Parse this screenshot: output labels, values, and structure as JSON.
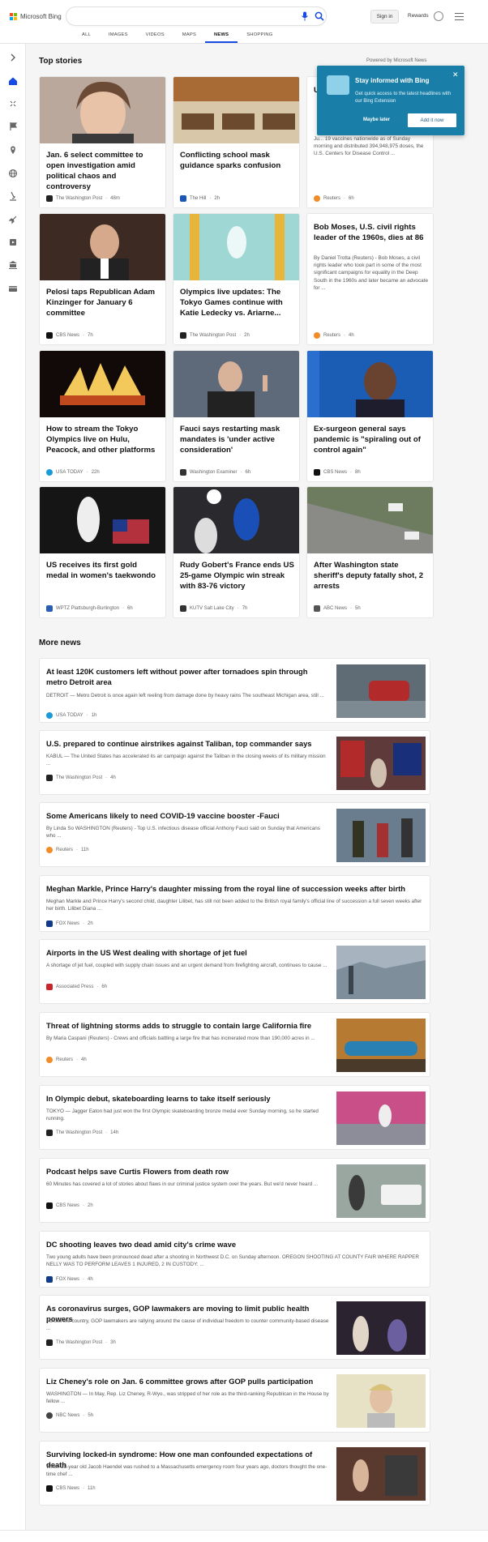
{
  "brand": {
    "name": "Microsoft Bing"
  },
  "search": {
    "placeholder": ""
  },
  "header": {
    "sign_in": "Sign in",
    "rewards": "Rewards"
  },
  "tabs": [
    {
      "label": "ALL"
    },
    {
      "label": "IMAGES"
    },
    {
      "label": "VIDEOS"
    },
    {
      "label": "MAPS"
    },
    {
      "label": "NEWS"
    },
    {
      "label": "SHOPPING"
    }
  ],
  "sections": {
    "top_stories": "Top stories",
    "more_news": "More news",
    "powered": "Powered by Microsoft News"
  },
  "popup": {
    "title": "Stay informed with Bing",
    "description": "Get quick access to the latest headlines with our Bing Extension",
    "maybe_later": "Maybe later",
    "add_it": "Add it now"
  },
  "top_stories": [
    {
      "title": "Jan. 6 select committee to open investigation amid political chaos and controversy",
      "source": "The Washington Post",
      "age": "48m"
    },
    {
      "title": "Conflicting school mask guidance sparks confusion",
      "source": "The Hill",
      "age": "2h"
    },
    {
      "title": "U",
      "snippet": "Ju... 19 vaccines nationwide as of Sunday morning and distributed 394,948,975 doses, the U.S. Centers for Disease Control ...",
      "source": "Reuters",
      "age": "6h"
    },
    {
      "title": "Pelosi taps Republican Adam Kinzinger for January 6 committee",
      "source": "CBS News",
      "age": "7h"
    },
    {
      "title": "Olympics live updates: The Tokyo Games continue with Katie Ledecky vs. Ariarne...",
      "source": "The Washington Post",
      "age": "2h"
    },
    {
      "title": "Bob Moses, U.S. civil rights leader of the 1960s, dies at 86",
      "snippet": "By Daniel Trotta (Reuters) - Bob Moses, a civil rights leader who took part in some of the most significant campaigns for equality in the Deep South in the 1960s and later became an advocate for ...",
      "source": "Reuters",
      "age": "4h"
    },
    {
      "title": "How to stream the Tokyo Olympics live on Hulu, Peacock, and other platforms",
      "source": "USA TODAY",
      "age": "22h"
    },
    {
      "title": "Fauci says restarting mask mandates is 'under active consideration'",
      "source": "Washington Examiner",
      "age": "6h"
    },
    {
      "title": "Ex-surgeon general says pandemic is \"spiraling out of control again\"",
      "source": "CBS News",
      "age": "8h"
    },
    {
      "title": "US receives its first gold medal in women's taekwondo",
      "source": "WPTZ Plattsburgh-Burlington",
      "age": "6h"
    },
    {
      "title": "Rudy Gobert's France ends US 25-game Olympic win streak with 83-76 victory",
      "source": "KUTV Salt Lake City",
      "age": "7h"
    },
    {
      "title": "After Washington state sheriff's deputy fatally shot, 2 arrests",
      "source": "ABC News",
      "age": "5h"
    }
  ],
  "more_news": [
    {
      "title": "At least 120K customers left without power after tornadoes spin through metro Detroit area",
      "snippet": "DETROIT — Metro Detroit is once again left reeling from damage done by heavy rains The southeast Michigan area, still ...",
      "source": "USA TODAY",
      "age": "1h"
    },
    {
      "title": "U.S. prepared to continue airstrikes against Taliban, top commander says",
      "snippet": "KABUL — The United States has accelerated its air campaign against the Taliban in the closing weeks of its military mission ...",
      "source": "The Washington Post",
      "age": "4h"
    },
    {
      "title": "Some Americans likely to need COVID-19 vaccine booster -Fauci",
      "snippet": "By Linda So WASHINGTON (Reuters) - Top U.S. infectious disease official Anthony Fauci said on Sunday that Americans who ...",
      "source": "Reuters",
      "age": "11h"
    },
    {
      "title": "Meghan Markle, Prince Harry's daughter missing from the royal line of succession weeks after birth",
      "snippet": "Meghan Markle and Prince Harry's second child, daughter Lilibet, has still not been added to the British royal family's official line of succession a full seven weeks after her birth. Lilibet Diana ...",
      "source": "FOX News",
      "age": "2h"
    },
    {
      "title": "Airports in the US West dealing with shortage of jet fuel",
      "snippet": "A shortage of jet fuel, coupled with supply chain issues and an urgent demand from firefighting aircraft, continues to cause ...",
      "source": "Associated Press",
      "age": "6h"
    },
    {
      "title": "Threat of lightning storms adds to struggle to contain large California fire",
      "snippet": "By Maria Caspani (Reuters) - Crews and officials battling a large fire that has incinerated more than 190,000 acres in ...",
      "source": "Reuters",
      "age": "4h"
    },
    {
      "title": "In Olympic debut, skateboarding learns to take itself seriously",
      "snippet": "TOKYO — Jagger Eaton had just won the first Olympic skateboarding bronze medal ever Sunday morning, so he started running.",
      "source": "The Washington Post",
      "age": "14h"
    },
    {
      "title": "Podcast helps save Curtis Flowers from death row",
      "snippet": "60 Minutes has covered a lot of stories about flaws in our criminal justice system over the years. But we'd never heard ...",
      "source": "CBS News",
      "age": "2h"
    },
    {
      "title": "DC shooting leaves two dead amid city's crime wave",
      "snippet": "Two young adults have been pronounced dead after a shooting in Northwest D.C. on Sunday afternoon. OREGON SHOOTING AT COUNTY FAIR WHERE RAPPER NELLY WAS TO PERFORM LEAVES 1 INJURED, 2 IN CUSTODY: ...",
      "source": "FOX News",
      "age": "4h"
    },
    {
      "title": "As coronavirus surges, GOP lawmakers are moving to limit public health powers",
      "snippet": "Across the country, GOP lawmakers are rallying around the cause of individual freedom to counter community-based disease ...",
      "source": "The Washington Post",
      "age": "3h"
    },
    {
      "title": "Liz Cheney's role on Jan. 6 committee grows after GOP pulls participation",
      "snippet": "WASHINGTON — In May, Rep. Liz Cheney, R-Wyo., was stripped of her role as the third-ranking Republican in the House by fellow ...",
      "source": "NBC News",
      "age": "5h"
    },
    {
      "title": "Surviving locked-in syndrome: How one man confounded expectations of death",
      "snippet": "When 28-year old Jacob Haendel was rushed to a Massachusetts emergency room four years ago, doctors thought the one-time chef ...",
      "source": "CBS News",
      "age": "11h"
    }
  ]
}
